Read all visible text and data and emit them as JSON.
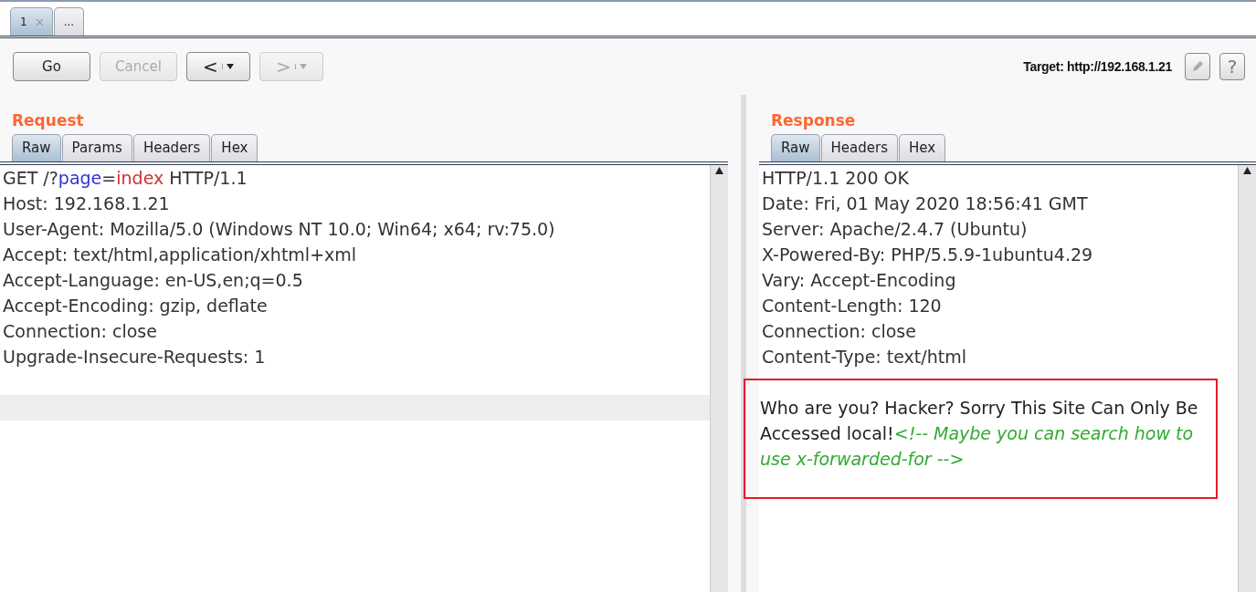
{
  "tabs": [
    {
      "label": "1",
      "closable": true,
      "selected": true
    },
    {
      "label": "...",
      "closable": false,
      "selected": false
    }
  ],
  "toolbar": {
    "buttons": [
      {
        "kind": "text",
        "label": "Go",
        "disabled": false
      },
      {
        "kind": "text",
        "label": "Cancel",
        "disabled": true
      },
      {
        "kind": "back",
        "label": "<",
        "disabled": false
      },
      {
        "kind": "forward",
        "label": ">",
        "disabled": true
      }
    ],
    "target": "Target: http://192.168.1.21",
    "help": "?"
  },
  "request": {
    "title": "Request",
    "tabs": [
      {
        "label": "Raw",
        "selected": true
      },
      {
        "label": "Params",
        "selected": false
      },
      {
        "label": "Headers",
        "selected": false
      },
      {
        "label": "Hex",
        "selected": false
      }
    ],
    "lines": [
      [
        {
          "kind": "plain",
          "text": "GET /?"
        },
        {
          "kind": "param_name",
          "text": "page"
        },
        {
          "kind": "plain",
          "text": "="
        },
        {
          "kind": "param_value",
          "text": "index"
        },
        {
          "kind": "plain",
          "text": " HTTP/1.1"
        }
      ],
      [
        {
          "kind": "plain",
          "text": "Host: 192.168.1.21"
        }
      ],
      [
        {
          "kind": "plain",
          "text": "User-Agent: Mozilla/5.0 (Windows NT 10.0; Win64; x64; rv:75.0)"
        }
      ],
      [
        {
          "kind": "plain",
          "text": "Accept: text/html,application/xhtml+xml"
        }
      ],
      [
        {
          "kind": "plain",
          "text": "Accept-Language: en-US,en;q=0.5"
        }
      ],
      [
        {
          "kind": "plain",
          "text": "Accept-Encoding: gzip, deflate"
        }
      ],
      [
        {
          "kind": "plain",
          "text": "Connection: close"
        }
      ],
      [
        {
          "kind": "plain",
          "text": "Upgrade-Insecure-Requests: 1"
        }
      ]
    ]
  },
  "response": {
    "title": "Response",
    "tabs": [
      {
        "label": "Raw",
        "selected": true
      },
      {
        "label": "Headers",
        "selected": false
      },
      {
        "label": "Hex",
        "selected": false
      }
    ],
    "lines": [
      "HTTP/1.1 200 OK",
      "Date: Fri, 01 May 2020 18:56:41 GMT",
      "Server: Apache/2.4.7 (Ubuntu)",
      "X-Powered-By: PHP/5.5.9-1ubuntu4.29",
      "Vary: Accept-Encoding",
      "Content-Length: 120",
      "Connection: close",
      "Content-Type: text/html"
    ],
    "body": {
      "text": "Who are you? Hacker? Sorry This Site Can Only Be Accessed local!",
      "comment": "<!-- Maybe you can search how to use x-forwarded-for -->",
      "highlighted": true
    }
  }
}
